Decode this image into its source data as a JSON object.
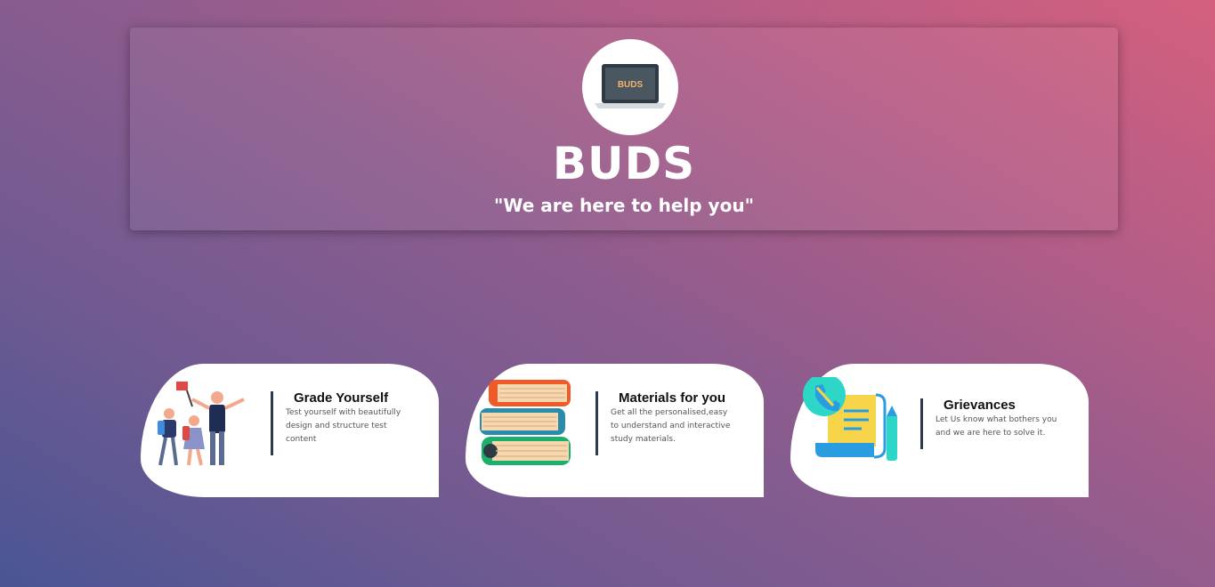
{
  "hero": {
    "logo_text": "BUDS",
    "title": "BUDS",
    "tagline": "\"We are here to help you\""
  },
  "cards": [
    {
      "heading": "Grade Yourself",
      "text": "Test yourself with beautifully design and structure test content",
      "icon": "students-with-flag-icon"
    },
    {
      "heading": "Materials for you",
      "text": "Get all the personalised,easy to understand and interactive study materials.",
      "icon": "book-stack-icon"
    },
    {
      "heading": "Grievances",
      "text": "Let Us know what bothers you and we are here to solve it.",
      "icon": "phone-scroll-pencil-icon"
    }
  ],
  "colors": {
    "gradient_start": "#4a5594",
    "gradient_end": "#d4607e",
    "divider": "#2d3a4d"
  }
}
